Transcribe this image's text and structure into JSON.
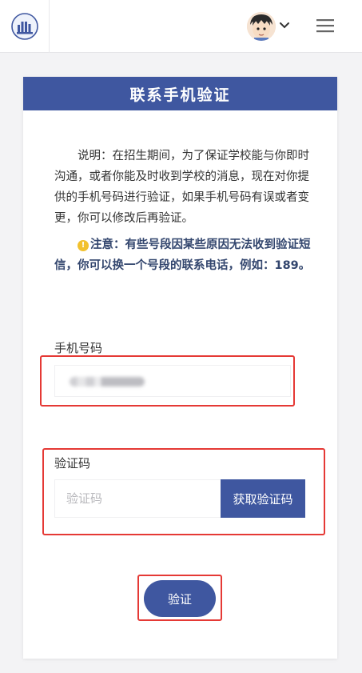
{
  "header": {
    "logo_icon": "school-logo-icon",
    "avatar_icon": "user-avatar",
    "dropdown_icon": "chevron-down-icon",
    "menu_icon": "hamburger-menu-icon"
  },
  "card": {
    "title": "联系手机验证",
    "description": "说明：在招生期间，为了保证学校能与你即时沟通，或者你能及时收到学校的消息，现在对你提供的手机号码进行验证，如果手机号码有误或者变更，你可以修改后再验证。",
    "note": "注意：有些号段因某些原因无法收到验证短信，你可以换一个号段的联系电话，例如：189。"
  },
  "form": {
    "phone_label": "手机号码",
    "code_label": "验证码",
    "code_placeholder": "验证码",
    "get_code_button": "获取验证码",
    "verify_button": "验证"
  },
  "colors": {
    "primary": "#3f57a0",
    "highlight_border": "#e53935",
    "background": "#f3f3f5"
  }
}
